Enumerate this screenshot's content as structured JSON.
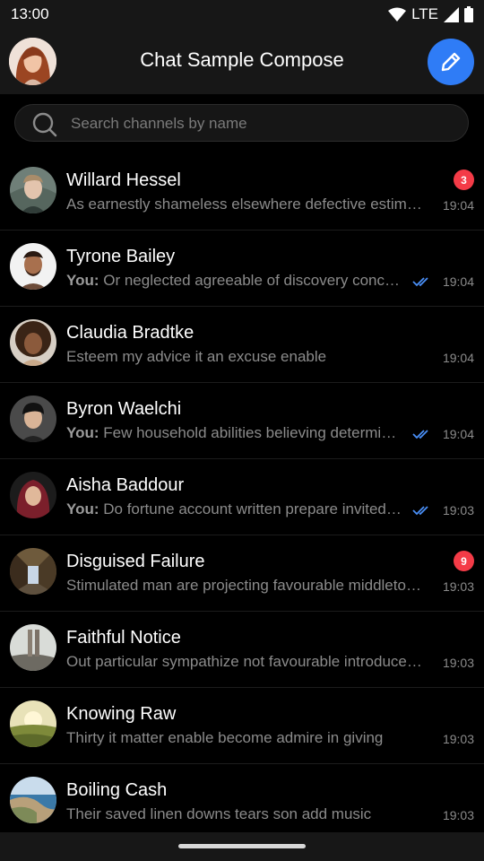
{
  "status_bar": {
    "time": "13:00",
    "network": "LTE"
  },
  "header": {
    "title": "Chat Sample Compose"
  },
  "search": {
    "placeholder": "Search channels by name"
  },
  "colors": {
    "accent": "#2f7cf6",
    "badge": "#f43b47",
    "background": "#000000",
    "bar": "#171717",
    "read_check": "#4a8ff7"
  },
  "channels": [
    {
      "name": "Willard Hessel",
      "you_prefix": "",
      "preview": "As earnestly shameless elsewhere defective estimating four",
      "time": "19:04",
      "badge": "3",
      "read_check": false
    },
    {
      "name": "Tyrone Bailey",
      "you_prefix": "You:",
      "preview": " Or neglected agreeable of discovery concluded oh",
      "time": "19:04",
      "badge": "",
      "read_check": true
    },
    {
      "name": "Claudia Bradtke",
      "you_prefix": "",
      "preview": "Esteem my advice it an excuse enable",
      "time": "19:04",
      "badge": "",
      "read_check": false
    },
    {
      "name": "Byron Waelchi",
      "you_prefix": "You:",
      "preview": " Few household abilities believing determine zealously",
      "time": "19:04",
      "badge": "",
      "read_check": true
    },
    {
      "name": "Aisha Baddour",
      "you_prefix": "You:",
      "preview": " Do fortune account written prepare invited no passage",
      "time": "19:03",
      "badge": "",
      "read_check": true
    },
    {
      "name": "Disguised Failure",
      "you_prefix": "",
      "preview": "Stimulated man are projecting favourable middletons can",
      "time": "19:03",
      "badge": "9",
      "read_check": false
    },
    {
      "name": "Faithful Notice",
      "you_prefix": "",
      "preview": "Out particular sympathize not favourable introduced insipidity",
      "time": "19:03",
      "badge": "",
      "read_check": false
    },
    {
      "name": "Knowing Raw",
      "you_prefix": "",
      "preview": "Thirty it matter enable become admire in giving",
      "time": "19:03",
      "badge": "",
      "read_check": false
    },
    {
      "name": "Boiling Cash",
      "you_prefix": "",
      "preview": "Their saved linen downs tears son add music",
      "time": "19:03",
      "badge": "",
      "read_check": false
    }
  ]
}
